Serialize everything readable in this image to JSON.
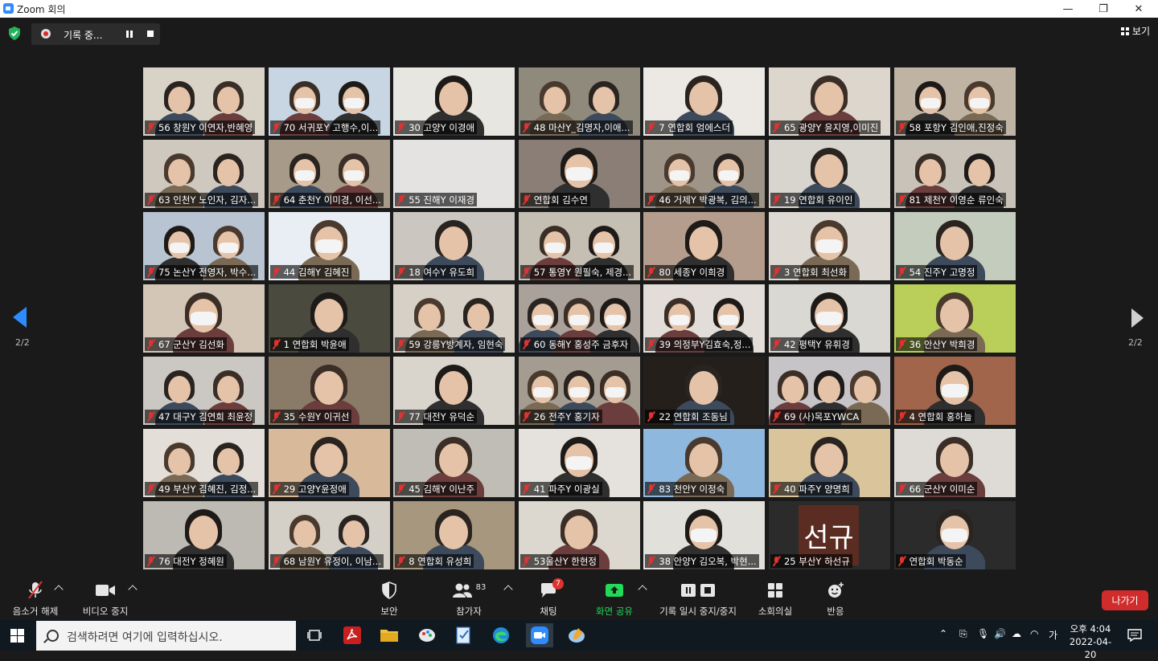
{
  "window": {
    "title": "Zoom 회의",
    "minimize": "—",
    "maximize": "❐",
    "close": "✕"
  },
  "topbar": {
    "recording_label": "기록 중...",
    "view_label": "보기"
  },
  "gallery": {
    "page_left": "2/2",
    "page_right": "2/2",
    "participants": [
      {
        "name": "56 창원Y 이연자,반혜영",
        "bg": "#d9d2c7",
        "people": 2,
        "mask": false
      },
      {
        "name": "70 서귀포Y 고행수,이...",
        "bg": "#c8d6e3",
        "people": 2,
        "mask": true
      },
      {
        "name": "30 고양Y 이경애",
        "bg": "#e8e6e1",
        "people": 1,
        "mask": false
      },
      {
        "name": "48 마산Y_김명자,이애...",
        "bg": "#8f8a7c",
        "people": 2,
        "mask": false
      },
      {
        "name": "7 연합회 엄에스더",
        "bg": "#ece9e4",
        "people": 1,
        "mask": false
      },
      {
        "name": "65 광양Y 윤지영,이미진",
        "bg": "#dcd6cd",
        "people": 1,
        "mask": false
      },
      {
        "name": "58 포항Y 김인애,진정숙",
        "bg": "#bfb4a3",
        "people": 2,
        "mask": true
      },
      {
        "name": "63 인천Y 노인자, 김자...",
        "bg": "#cfc8bf",
        "people": 2,
        "mask": false
      },
      {
        "name": "64 춘천Y 이미경, 이선...",
        "bg": "#a79a88",
        "people": 2,
        "mask": true
      },
      {
        "name": "55 진해Y 이재경",
        "bg": "#e4e3e1",
        "people": 0,
        "mask": false
      },
      {
        "name": "연합회 김수연",
        "bg": "#8a7e76",
        "people": 1,
        "mask": true
      },
      {
        "name": "46 거제Y 박광복, 김의...",
        "bg": "#9e9588",
        "people": 2,
        "mask": true
      },
      {
        "name": "19 연합회 유이인",
        "bg": "#d8d5cf",
        "people": 1,
        "mask": false
      },
      {
        "name": "81 제천Y 이영순 류인숙",
        "bg": "#c9c2b9",
        "people": 2,
        "mask": false
      },
      {
        "name": "75 논산Y 전영자, 박수...",
        "bg": "#b8c4d1",
        "people": 2,
        "mask": true
      },
      {
        "name": "44 김해Y 김혜진",
        "bg": "#e9eef4",
        "people": 1,
        "mask": true
      },
      {
        "name": "18 여수Y 유도희",
        "bg": "#cbc6bf",
        "people": 1,
        "mask": false
      },
      {
        "name": "57 통영Y 원필숙, 제경...",
        "bg": "#c4beb3",
        "people": 2,
        "mask": true
      },
      {
        "name": "80 세종Y 이희경",
        "bg": "#b49d8c",
        "people": 1,
        "mask": false
      },
      {
        "name": "3 연합회 최선화",
        "bg": "#ddd9d2",
        "people": 1,
        "mask": true
      },
      {
        "name": "54 진주Y 고명정",
        "bg": "#c3ccbd",
        "people": 1,
        "mask": false
      },
      {
        "name": "67 군산Y 김선화",
        "bg": "#d3c6b7",
        "people": 1,
        "mask": true
      },
      {
        "name": "1 연합회 박윤애",
        "bg": "#4a4a3e",
        "people": 1,
        "mask": false
      },
      {
        "name": "59 강릉Y방계자, 임현숙",
        "bg": "#d7d0c6",
        "people": 2,
        "mask": false
      },
      {
        "name": "60 동해Y 홍성주 금후자",
        "bg": "#a9a19a",
        "people": 3,
        "mask": true
      },
      {
        "name": "39 의정부Y김효숙,정...",
        "bg": "#e2ddd8",
        "people": 2,
        "mask": true
      },
      {
        "name": "42 평택Y 유휘경",
        "bg": "#dad8d2",
        "people": 1,
        "mask": true
      },
      {
        "name": "36 안산Y 박희경",
        "bg": "#b9cf5a",
        "people": 1,
        "mask": false
      },
      {
        "name": "47 대구Y 김연희 최윤정",
        "bg": "#cbc8c3",
        "people": 2,
        "mask": false
      },
      {
        "name": "35 수원Y 이귀선",
        "bg": "#8a7a68",
        "people": 1,
        "mask": false
      },
      {
        "name": "77 대전Y 유덕순",
        "bg": "#d9d4cc",
        "people": 1,
        "mask": false
      },
      {
        "name": "26 전주Y 홍기자",
        "bg": "#a49c90",
        "people": 3,
        "mask": true
      },
      {
        "name": "22 연합회 조동님",
        "bg": "#241f1b",
        "people": 1,
        "mask": false
      },
      {
        "name": "69 (사)목포YWCA",
        "bg": "#c7c4c8",
        "people": 3,
        "mask": false
      },
      {
        "name": "4 연합회 홍하늘",
        "bg": "#a0654a",
        "people": 1,
        "mask": true
      },
      {
        "name": "49 부산Y 김혜진, 김정...",
        "bg": "#e3dfd8",
        "people": 2,
        "mask": false
      },
      {
        "name": "29 고양Y윤정애",
        "bg": "#d8b999",
        "people": 1,
        "mask": false
      },
      {
        "name": "45 김해Y 이난주",
        "bg": "#c0bdb6",
        "people": 1,
        "mask": false
      },
      {
        "name": "41 파주Y 이광실",
        "bg": "#e5e1dc",
        "people": 1,
        "mask": true
      },
      {
        "name": "83 천안Y 이정숙",
        "bg": "#8fb8de",
        "people": 1,
        "mask": false
      },
      {
        "name": "40 파주Y 양명희",
        "bg": "#d9c49c",
        "people": 1,
        "mask": false
      },
      {
        "name": "66 군산Y 이미순",
        "bg": "#dedbd6",
        "people": 1,
        "mask": false
      },
      {
        "name": "76 대전Y 정혜원",
        "bg": "#bdb9b3",
        "people": 1,
        "mask": false
      },
      {
        "name": "68 남원Y 유정이, 이남...",
        "bg": "#d4d0c8",
        "people": 2,
        "mask": false
      },
      {
        "name": "8 연합회 유성희",
        "bg": "#a8977f",
        "people": 1,
        "mask": false
      },
      {
        "name": "53울산Y 한현정",
        "bg": "#dcd8d0",
        "people": 1,
        "mask": false
      },
      {
        "name": "38 안양Y 김오복, 박현...",
        "bg": "#e2e0db",
        "people": 1,
        "mask": true
      },
      {
        "name": "25 부산Y 하선규",
        "bg": "#2b2b2b",
        "people": 0,
        "mask": false,
        "avatar_text": "선규"
      },
      {
        "name": "연합회 박동순",
        "bg": "#2b2b2b",
        "people": 1,
        "mask": true
      }
    ]
  },
  "toolbar": {
    "unmute": "음소거 해제",
    "stop_video": "비디오 중지",
    "security": "보안",
    "participants": "참가자",
    "participants_count": "83",
    "chat": "채팅",
    "chat_badge": "7",
    "share_screen": "화면 공유",
    "pause_stop_recording": "기록 일시 중지/중지",
    "breakout_rooms": "소회의실",
    "reactions": "반응",
    "leave": "나가기"
  },
  "taskbar": {
    "search_placeholder": "검색하려면 여기에 입력하십시오.",
    "ime": "가",
    "time": "오후 4:04",
    "date": "2022-04-20"
  },
  "colors": {
    "zoom_blue": "#2d8cff",
    "leave_red": "#d12c2c",
    "share_green": "#23d959",
    "mic_red": "#e0322f"
  }
}
